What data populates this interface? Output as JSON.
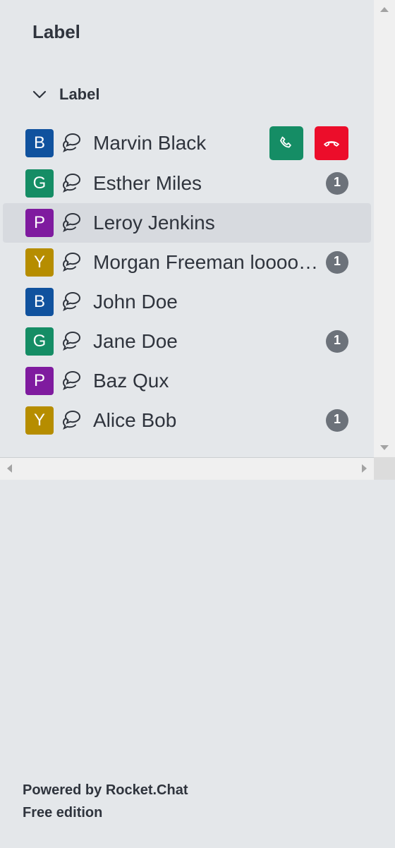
{
  "sidebar": {
    "title": "Label",
    "group_label": "Label",
    "items": [
      {
        "initial": "B",
        "avatar_color": "#10529e",
        "name": "Marvin Black",
        "badge": "",
        "incoming_call": true
      },
      {
        "initial": "G",
        "avatar_color": "#158d65",
        "name": "Esther Miles",
        "badge": "1"
      },
      {
        "initial": "P",
        "avatar_color": "#7f1b9f",
        "name": "Leroy Jenkins",
        "badge": "",
        "selected": true
      },
      {
        "initial": "Y",
        "avatar_color": "#b68d00",
        "name": "Morgan Freeman loooo…",
        "badge": "1"
      },
      {
        "initial": "B",
        "avatar_color": "#10529e",
        "name": "John Doe",
        "badge": ""
      },
      {
        "initial": "G",
        "avatar_color": "#158d65",
        "name": "Jane Doe",
        "badge": "1"
      },
      {
        "initial": "P",
        "avatar_color": "#7f1b9f",
        "name": "Baz Qux",
        "badge": ""
      },
      {
        "initial": "Y",
        "avatar_color": "#b68d00",
        "name": "Alice Bob",
        "badge": "1"
      }
    ],
    "call_icons": {
      "accept": "phone-icon",
      "decline": "phone-hangup-icon"
    }
  },
  "footer": {
    "powered_by": "Powered by Rocket.Chat",
    "edition": "Free edition"
  }
}
